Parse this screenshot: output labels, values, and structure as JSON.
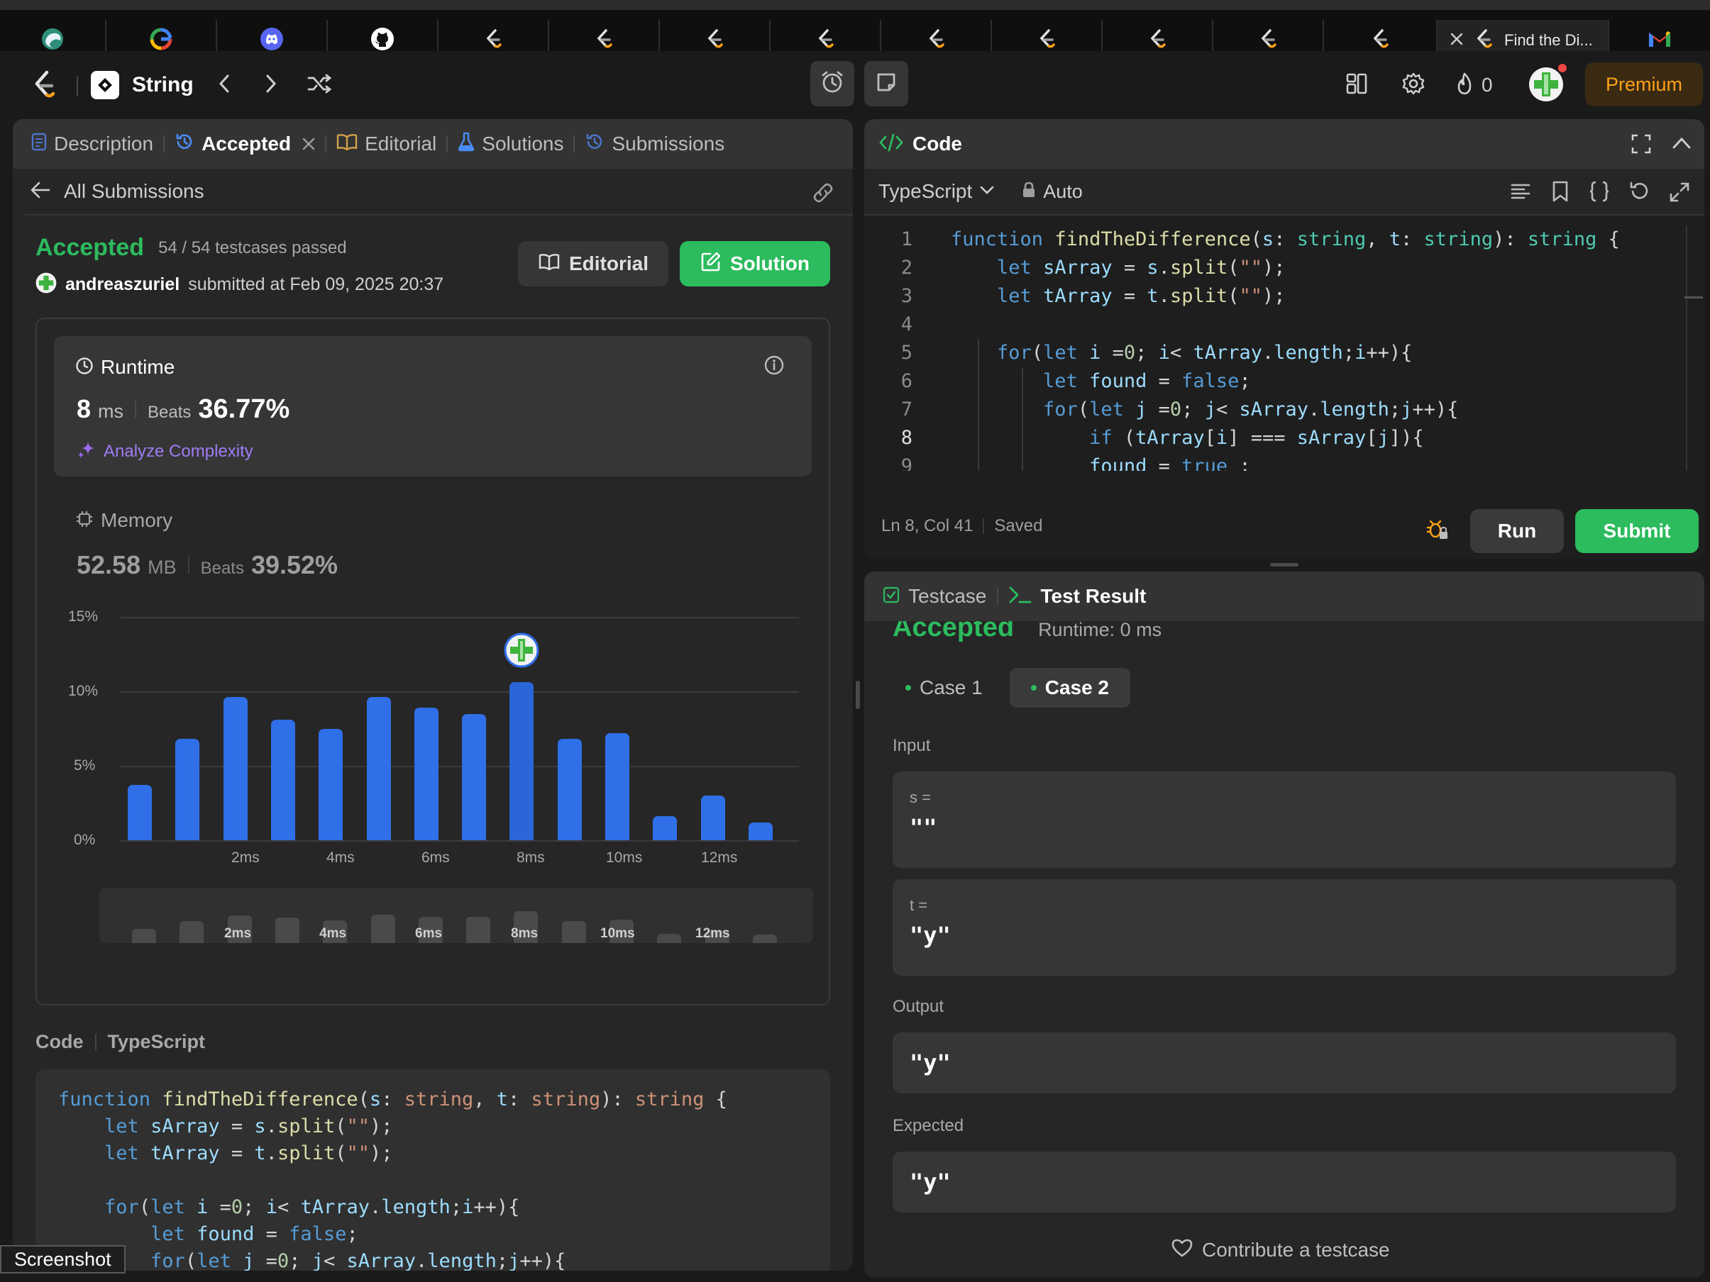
{
  "browser": {
    "tabs": [
      {
        "icon": "edge-icon"
      },
      {
        "icon": "google-icon"
      },
      {
        "icon": "discord-icon"
      },
      {
        "icon": "github-icon"
      },
      {
        "icon": "leetcode-icon"
      },
      {
        "icon": "leetcode-icon"
      },
      {
        "icon": "leetcode-icon"
      },
      {
        "icon": "leetcode-icon"
      },
      {
        "icon": "leetcode-icon"
      },
      {
        "icon": "leetcode-icon"
      },
      {
        "icon": "leetcode-icon"
      },
      {
        "icon": "leetcode-icon"
      },
      {
        "icon": "leetcode-icon"
      }
    ],
    "active_tab_title": "Find the Di...",
    "last_tab_icon": "gmail-icon"
  },
  "nav": {
    "problem_list": "String",
    "streak_count": "0",
    "premium_label": "Premium"
  },
  "left": {
    "tabs": {
      "description": "Description",
      "accepted": "Accepted",
      "editorial": "Editorial",
      "solutions": "Solutions",
      "submissions": "Submissions"
    },
    "back_label": "All Submissions",
    "status": "Accepted",
    "testcases": "54 / 54 testcases passed",
    "username": "andreaszuriel",
    "submitted_text": "submitted at Feb 09, 2025 20:37",
    "editorial_btn": "Editorial",
    "solution_btn": "Solution",
    "runtime": {
      "title": "Runtime",
      "value": "8",
      "unit": "ms",
      "beats_label": "Beats",
      "beats": "36.77%",
      "analyze": "Analyze Complexity"
    },
    "memory": {
      "title": "Memory",
      "value": "52.58",
      "unit": "MB",
      "beats_label": "Beats",
      "beats": "39.52%"
    },
    "code_label": "Code",
    "code_lang": "TypeScript"
  },
  "chart_data": {
    "type": "bar",
    "title": "Runtime distribution",
    "yticks": [
      "15%",
      "10%",
      "5%",
      "0%"
    ],
    "xticks": [
      "2ms",
      "4ms",
      "6ms",
      "8ms",
      "10ms",
      "12ms"
    ],
    "ylim": [
      0,
      15
    ],
    "values": [
      3.7,
      6.8,
      9.6,
      8.1,
      7.5,
      9.6,
      8.9,
      8.5,
      10.6,
      6.8,
      7.2,
      1.6,
      3.0,
      1.2
    ],
    "highlight_index": 8,
    "minimap_values": [
      2.0,
      3.9,
      5.2,
      4.6,
      4.0,
      5.3,
      4.9,
      4.8,
      6.2,
      3.9,
      4.1,
      0.9,
      1.7,
      0.7
    ],
    "minimap_xticks": [
      "2ms",
      "4ms",
      "6ms",
      "8ms",
      "10ms",
      "12ms"
    ]
  },
  "right": {
    "code_title": "Code",
    "language": "TypeScript",
    "mode": "Auto",
    "status_pos": "Ln 8, Col 41",
    "status_saved": "Saved",
    "run_btn": "Run",
    "submit_btn": "Submit",
    "testcase_tab": "Testcase",
    "result_tab": "Test Result",
    "result_status": "Accepted",
    "result_runtime": "Runtime: 0 ms",
    "case1": "Case 1",
    "case2": "Case 2",
    "input_label": "Input",
    "s_label": "s =",
    "s_value": "\"\"",
    "t_label": "t =",
    "t_value": "\"y\"",
    "output_label": "Output",
    "output_value": "\"y\"",
    "expected_label": "Expected",
    "expected_value": "\"y\"",
    "contribute": "Contribute a testcase"
  },
  "tooltip": "Screenshot"
}
